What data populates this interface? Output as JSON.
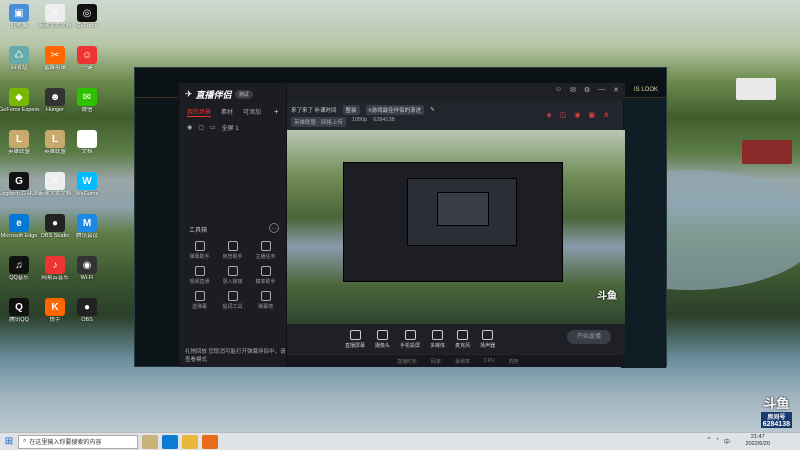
{
  "desktop": {
    "icons": [
      {
        "label": "此电脑",
        "color": "#4a90d9",
        "glyph": "▣"
      },
      {
        "label": "新建文本文档",
        "color": "#eee",
        "glyph": "≡"
      },
      {
        "label": "GeForce",
        "color": "#111",
        "glyph": "◎"
      },
      {
        "label": "回收站",
        "color": "#6aa",
        "glyph": "♺"
      },
      {
        "label": "蜜蜂剪辑",
        "color": "#f60",
        "glyph": "✂"
      },
      {
        "label": "一键",
        "color": "#e33",
        "glyph": "☺"
      },
      {
        "label": "GeForce Experience",
        "color": "#76b900",
        "glyph": "◆"
      },
      {
        "label": "Hunger",
        "color": "#333",
        "glyph": "☻"
      },
      {
        "label": "微信",
        "color": "#2dc100",
        "glyph": "✉"
      },
      {
        "label": "英雄联盟",
        "color": "#c8aa6e",
        "glyph": "L"
      },
      {
        "label": "英雄联盟",
        "color": "#c8aa6e",
        "glyph": "L"
      },
      {
        "label": "文档",
        "color": "#fff",
        "glyph": "▭"
      },
      {
        "label": "Logitech G HUB",
        "color": "#111",
        "glyph": "G"
      },
      {
        "label": "新建文本文档",
        "color": "#eee",
        "glyph": "≡"
      },
      {
        "label": "WeGame",
        "color": "#0bf",
        "glyph": "W"
      },
      {
        "label": "Microsoft Edge",
        "color": "#0078d4",
        "glyph": "e"
      },
      {
        "label": "OBS Studio",
        "color": "#222",
        "glyph": "●"
      },
      {
        "label": "腾讯会议",
        "color": "#1e88e5",
        "glyph": "M"
      },
      {
        "label": "QQ音乐",
        "color": "#111",
        "glyph": "♫"
      },
      {
        "label": "网易云音乐",
        "color": "#e33",
        "glyph": "♪"
      },
      {
        "label": "Wi-Fi",
        "color": "#333",
        "glyph": "◉"
      },
      {
        "label": "腾讯QQ",
        "color": "#111",
        "glyph": "Q"
      },
      {
        "label": "快手",
        "color": "#f60",
        "glyph": "K"
      },
      {
        "label": "OBS",
        "color": "#222",
        "glyph": "●"
      }
    ]
  },
  "lol_client": {
    "right_text": "IS LOOK"
  },
  "app": {
    "logo": "直播伴侣",
    "version": "测试",
    "tabs": [
      "我的场景",
      "素材",
      "可添加"
    ],
    "scene_name": "全屏 1",
    "tool_header": "工具箱",
    "tools": [
      "弹幕助手",
      "房管助手",
      "主播任务",
      "视频直通",
      "录入链接",
      "模率助手",
      "送弹幕",
      "提词工具",
      "弹幕墙"
    ],
    "notice": "礼物回放  您取消可能打开弹幕伴侣中，请查看模式",
    "header_icons": [
      "☺",
      "✉",
      "⚙",
      "—",
      "✕"
    ],
    "live_title": "来了来了 补课时间",
    "live_chip": "整装",
    "live_tag": "#游戏最佳伴侣的渐进",
    "live_info": [
      "英雄联盟 · 网格上传",
      "1080p",
      "6284138"
    ],
    "bottom_tools": [
      "直播屏幕",
      "摄像头",
      "手机投屏",
      "多媒体",
      "麦克风",
      "扬声器"
    ],
    "start_live": "开始直播",
    "status": [
      "直播时长",
      "码率",
      "丢帧率",
      "CPU",
      "内存"
    ]
  },
  "watermark": {
    "brand": "斗鱼",
    "room_label": "房间号",
    "room_number": "6284138"
  },
  "taskbar": {
    "search_placeholder": "在这里输入你要搜索的内容",
    "time": "21:47",
    "date": "2022/6/20",
    "tray": [
      "^",
      "◔",
      "中"
    ]
  }
}
